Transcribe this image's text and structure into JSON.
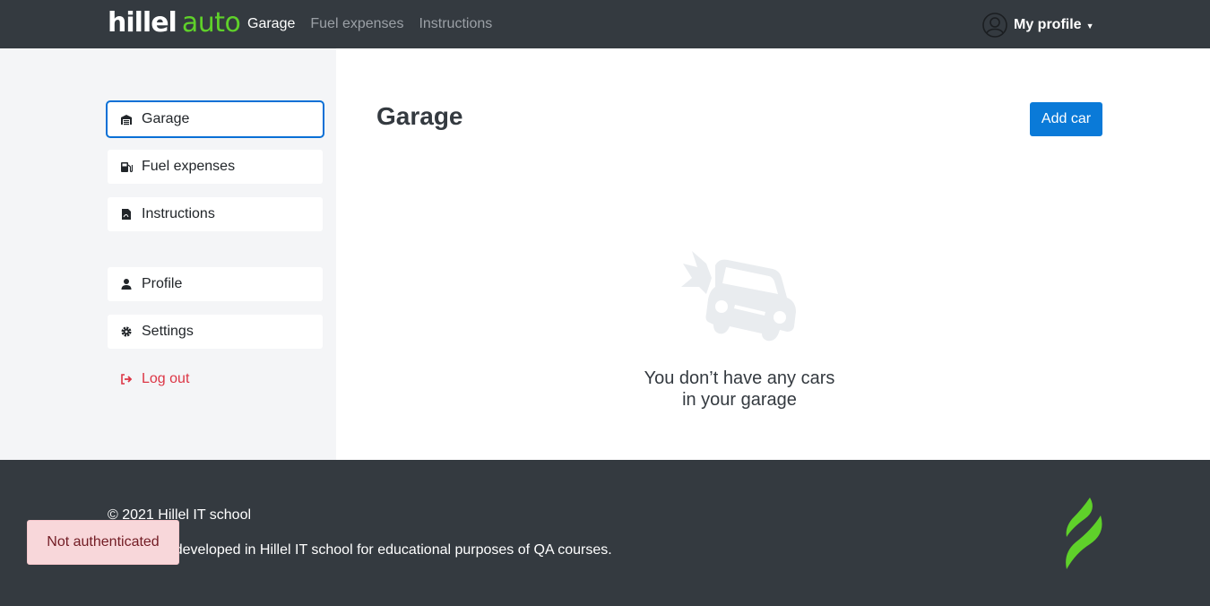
{
  "header": {
    "logo_main": "hillel",
    "logo_accent": "auto",
    "nav": [
      {
        "label": "Garage",
        "active": true
      },
      {
        "label": "Fuel expenses",
        "active": false
      },
      {
        "label": "Instructions",
        "active": false
      }
    ],
    "profile_label": "My profile",
    "profile_icon": "user-circle-icon"
  },
  "sidebar": {
    "items": [
      {
        "label": "Garage",
        "icon": "garage-icon",
        "active": true
      },
      {
        "label": "Fuel expenses",
        "icon": "fuel-pump-icon",
        "active": false
      },
      {
        "label": "Instructions",
        "icon": "pdf-file-icon",
        "active": false
      },
      {
        "label": "Profile",
        "icon": "user-icon",
        "active": false
      },
      {
        "label": "Settings",
        "icon": "gear-icon",
        "active": false
      },
      {
        "label": "Log out",
        "icon": "logout-icon",
        "active": false
      }
    ]
  },
  "main": {
    "title": "Garage",
    "add_button": "Add car",
    "empty_line1": "You don’t have any cars",
    "empty_line2": "in your garage",
    "empty_icon": "car-crash-icon"
  },
  "footer": {
    "copyright": "© 2021 Hillel IT school",
    "description": "Hillel auto developed in Hillel IT school for educational purposes of QA courses.",
    "logo_icon": "hillel-flame-logo"
  },
  "toast": {
    "message": "Not authenticated"
  },
  "colors": {
    "header_bg": "#343a40",
    "brand_green": "#5fd12a",
    "primary": "#0a7ad8",
    "danger": "#dc3545",
    "toast_bg": "#f8d7da"
  }
}
